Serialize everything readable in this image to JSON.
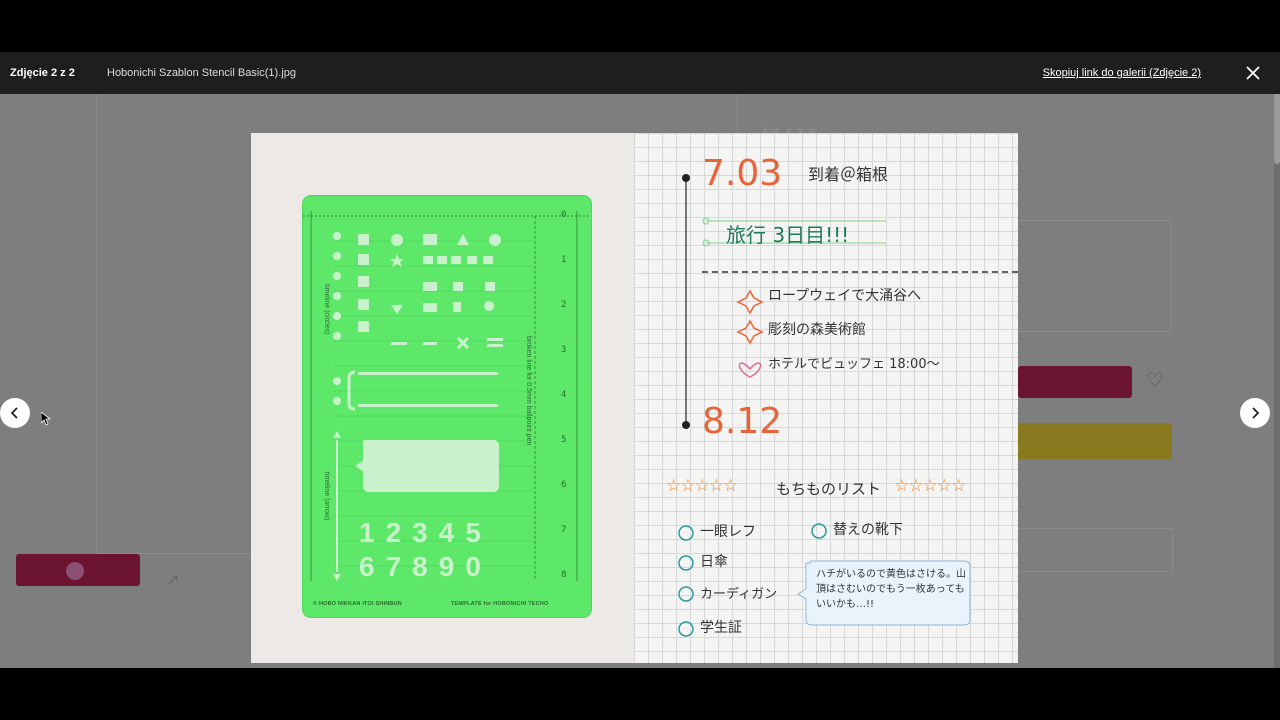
{
  "header": {
    "counter": "Zdjęcie 2 z 2",
    "filename": "Hobonichi Szablon Stencil Basic(1).jpg",
    "copy_link": "Skopiuj link do galerii (Zdjęcie 2)"
  },
  "nav": {
    "prev_icon": "chevron-left-icon",
    "next_icon": "chevron-right-icon",
    "close_icon": "close-icon"
  },
  "photo": {
    "stencil": {
      "label_circles": "timeline (circles)",
      "label_arrow": "timeline (arrow)",
      "label_broken": "broken line for 0.5mm ballpoint pen",
      "footer": "© HOBO NIKKAN ITOI SHINBUN",
      "footer_right": "TEMPLATE for HOBONICHI TECHO",
      "digits": [
        "1",
        "2",
        "3",
        "4",
        "5",
        "6",
        "7",
        "8",
        "9",
        "0"
      ],
      "ruler": [
        "0",
        "1",
        "2",
        "3",
        "4",
        "5",
        "6",
        "7",
        "8"
      ]
    },
    "journal": {
      "date1": "7.03",
      "arrival": "到着＠箱根",
      "trip": "旅行 3日目!!!",
      "plans": [
        "ロープウェイで大涌谷へ",
        "彫刻の森美術館",
        "ホテルでビュッフェ 18:00〜"
      ],
      "date2": "8.12",
      "list_title": "もちものリスト",
      "items_left": [
        "一眼レフ",
        "日傘",
        "カーディガン",
        "学生証"
      ],
      "items_right": [
        "替えの靴下"
      ],
      "note": "ハチがいるので黄色はさける。山頂はさむいのでもう一枚あってもいいかも…!!"
    }
  },
  "colors": {
    "header_bg": "#1e1e1e",
    "stencil": "#5ee86a",
    "accent_orange": "#e8643a",
    "accent_teal": "#2a9aa0",
    "accent_pink": "#e06a9a"
  }
}
